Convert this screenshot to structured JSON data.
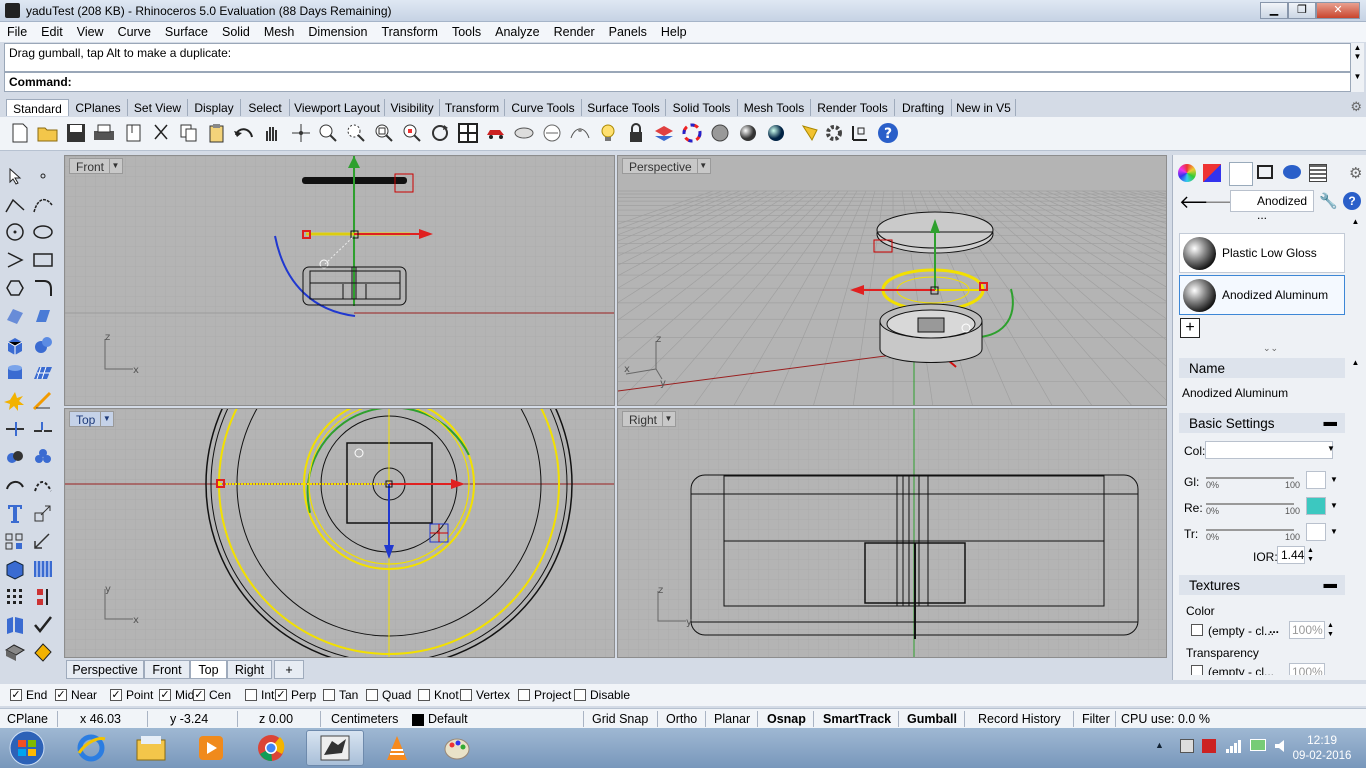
{
  "window": {
    "title": "yaduTest (208 KB) - Rhinoceros 5.0 Evaluation (88 Days Remaining)",
    "min": "▁",
    "max": "❐",
    "close": "✕"
  },
  "menu": [
    "File",
    "Edit",
    "View",
    "Curve",
    "Surface",
    "Solid",
    "Mesh",
    "Dimension",
    "Transform",
    "Tools",
    "Analyze",
    "Render",
    "Panels",
    "Help"
  ],
  "command": {
    "history": "Drag gumball, tap Alt to make a duplicate:",
    "prompt": "Command:"
  },
  "toolbar_tabs": [
    "Standard",
    "CPlanes",
    "Set View",
    "Display",
    "Select",
    "Viewport Layout",
    "Visibility",
    "Transform",
    "Curve Tools",
    "Surface Tools",
    "Solid Tools",
    "Mesh Tools",
    "Render Tools",
    "Drafting",
    "New in V5"
  ],
  "toolbar_icons": [
    "new-icon",
    "open-icon",
    "save-icon",
    "print-icon",
    "import-icon",
    "cut-icon",
    "copy-icon",
    "paste-icon",
    "undo-icon",
    "pan-icon",
    "rotate-view-icon",
    "zoom-icon",
    "zoom-window-icon",
    "zoom-extents-icon",
    "zoom-selected-icon",
    "rotate-icon",
    "four-viewports-icon",
    "car-icon",
    "named-view-icon",
    "cplane-icon",
    "light-icon",
    "lock-icon",
    "layer-icon",
    "color-wheel-icon",
    "wireframe-sphere-icon",
    "shaded-sphere-icon",
    "rendered-sphere-icon",
    "spotlight-icon",
    "options-icon",
    "analyze-icon",
    "help-icon"
  ],
  "viewports": {
    "front": "Front",
    "perspective": "Perspective",
    "top": "Top",
    "right": "Right"
  },
  "viewport_tabs": [
    "Perspective",
    "Front",
    "Top",
    "Right"
  ],
  "osnaps": [
    {
      "label": "End",
      "checked": true
    },
    {
      "label": "Near",
      "checked": true
    },
    {
      "label": "Point",
      "checked": true
    },
    {
      "label": "Mid",
      "checked": true
    },
    {
      "label": "Cen",
      "checked": true
    },
    {
      "label": "Int",
      "checked": false
    },
    {
      "label": "Perp",
      "checked": true
    },
    {
      "label": "Tan",
      "checked": false
    },
    {
      "label": "Quad",
      "checked": false
    },
    {
      "label": "Knot",
      "checked": false
    },
    {
      "label": "Vertex",
      "checked": false
    },
    {
      "label": "Project",
      "checked": false
    },
    {
      "label": "Disable",
      "checked": false
    }
  ],
  "status": {
    "cplane": "CPlane",
    "x": "x 46.03",
    "y": "y -3.24",
    "z": "z 0.00",
    "units": "Centimeters",
    "layer": "Default",
    "grid_snap": "Grid Snap",
    "ortho": "Ortho",
    "planar": "Planar",
    "osnap": "Osnap",
    "smarttrack": "SmartTrack",
    "gumball": "Gumball",
    "record_history": "Record History",
    "filter": "Filter",
    "cpu": "CPU use: 0.0 %"
  },
  "panel": {
    "dropdown": "Anodized ...",
    "materials": [
      "Plastic Low Gloss",
      "Anodized Aluminum"
    ],
    "add": "+",
    "name_header": "Name",
    "name_value": "Anodized Aluminum",
    "basic_header": "Basic Settings",
    "col": "Col:",
    "gl": "Gl:",
    "re": "Re:",
    "tr": "Tr:",
    "pct0": "0%",
    "pct100": "100",
    "ior_label": "IOR:",
    "ior": "1.44",
    "textures_header": "Textures",
    "tex_color": "Color",
    "tex_color_value": "(empty - cl...",
    "tex_color_pct": "100%",
    "tex_transparency": "Transparency",
    "tex_trans_value": "(empty - cl...",
    "tex_trans_pct": "100%",
    "minus": "▬",
    "reflect_color": "#3cc8c0",
    "dots": "...",
    "collapse": "⌄⌄"
  },
  "axes": {
    "z": "z",
    "x": "x",
    "y": "y"
  },
  "taskbar": {
    "time": "12:19",
    "date": "09-02-2016"
  }
}
